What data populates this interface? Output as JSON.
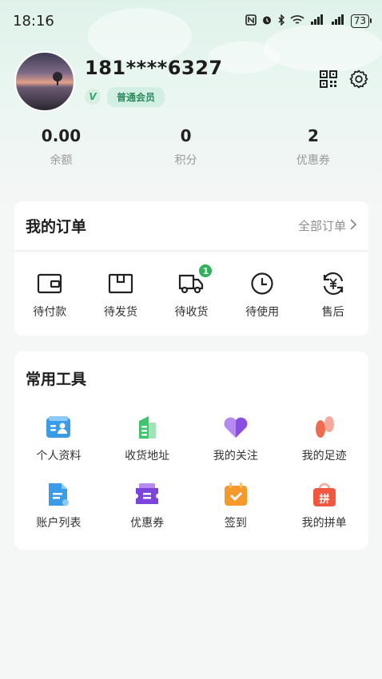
{
  "status_bar": {
    "time": "18:16",
    "battery": "73"
  },
  "profile": {
    "phone": "181****6327",
    "member_level": "普通会员",
    "verified_mark": "V"
  },
  "stats": [
    {
      "value": "0.00",
      "label": "余额"
    },
    {
      "value": "0",
      "label": "积分"
    },
    {
      "value": "2",
      "label": "优惠券"
    }
  ],
  "orders": {
    "title": "我的订单",
    "all_label": "全部订单",
    "items": [
      {
        "label": "待付款",
        "icon": "wallet-icon"
      },
      {
        "label": "待发货",
        "icon": "package-icon"
      },
      {
        "label": "待收货",
        "icon": "truck-icon",
        "badge": "1"
      },
      {
        "label": "待使用",
        "icon": "clock-icon"
      },
      {
        "label": "售后",
        "icon": "refund-icon"
      }
    ]
  },
  "tools": {
    "title": "常用工具",
    "items": [
      {
        "label": "个人资料",
        "icon": "profile-card-icon",
        "color": "#3a9be8"
      },
      {
        "label": "收货地址",
        "icon": "address-icon",
        "color": "#3cc56b"
      },
      {
        "label": "我的关注",
        "icon": "heart-icon",
        "color": "#8a4fe0"
      },
      {
        "label": "我的足迹",
        "icon": "footprint-icon",
        "color": "#f06a4f"
      },
      {
        "label": "账户列表",
        "icon": "document-icon",
        "color": "#3a9be8"
      },
      {
        "label": "优惠券",
        "icon": "coupon-icon",
        "color": "#7b45dc"
      },
      {
        "label": "签到",
        "icon": "calendar-check-icon",
        "color": "#f59a2a"
      },
      {
        "label": "我的拼单",
        "icon": "shopping-bag-icon",
        "color": "#f0573e"
      }
    ],
    "bag_char": "拼"
  }
}
